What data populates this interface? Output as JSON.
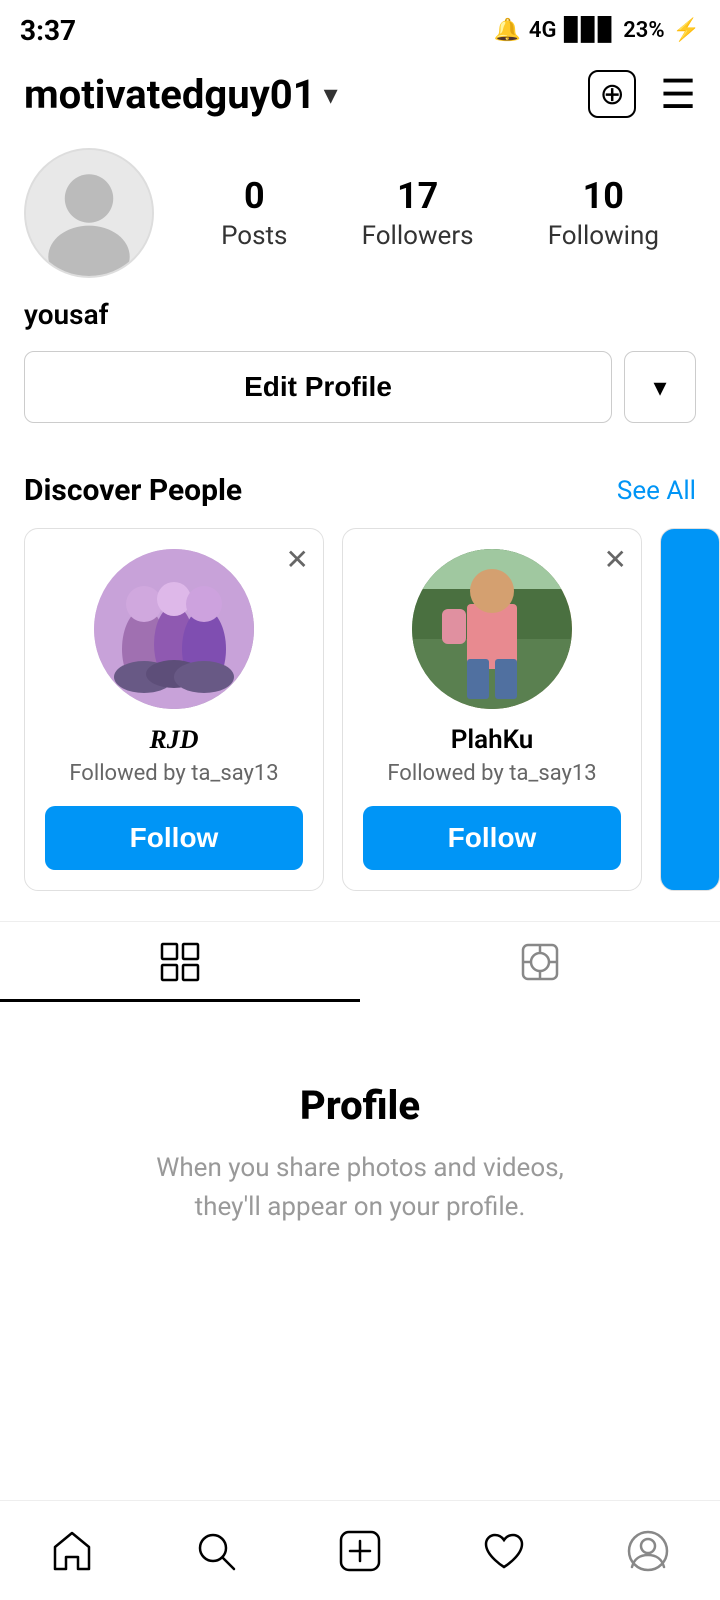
{
  "statusBar": {
    "time": "3:37",
    "battery": "23%",
    "signal": "4G"
  },
  "topNav": {
    "username": "motivatedguy01",
    "dropdownIcon": "▾",
    "addIcon": "+",
    "menuIcon": "≡"
  },
  "profile": {
    "avatarAlt": "profile avatar",
    "stats": {
      "posts": {
        "number": "0",
        "label": "Posts"
      },
      "followers": {
        "number": "17",
        "label": "Followers"
      },
      "following": {
        "number": "10",
        "label": "Following"
      }
    },
    "name": "yousaf",
    "editProfileBtn": "Edit Profile",
    "dropdownBtn": "▾"
  },
  "discoverPeople": {
    "title": "Discover People",
    "seeAll": "See All",
    "cards": [
      {
        "id": "card1",
        "username": "RJD",
        "isCursive": true,
        "followedBy": "Followed by ta_say13",
        "followBtn": "Follow"
      },
      {
        "id": "card2",
        "username": "PlahKu",
        "isCursive": false,
        "followedBy": "Followed by ta_say13",
        "followBtn": "Follow"
      }
    ]
  },
  "tabs": {
    "gridTab": "grid",
    "tagTab": "tag"
  },
  "emptyState": {
    "title": "Profile",
    "text": "When you share photos and videos,\nthey'll appear on your profile."
  },
  "bottomNav": {
    "home": "⌂",
    "search": "🔍",
    "add": "+",
    "heart": "♡",
    "profile": "●"
  }
}
